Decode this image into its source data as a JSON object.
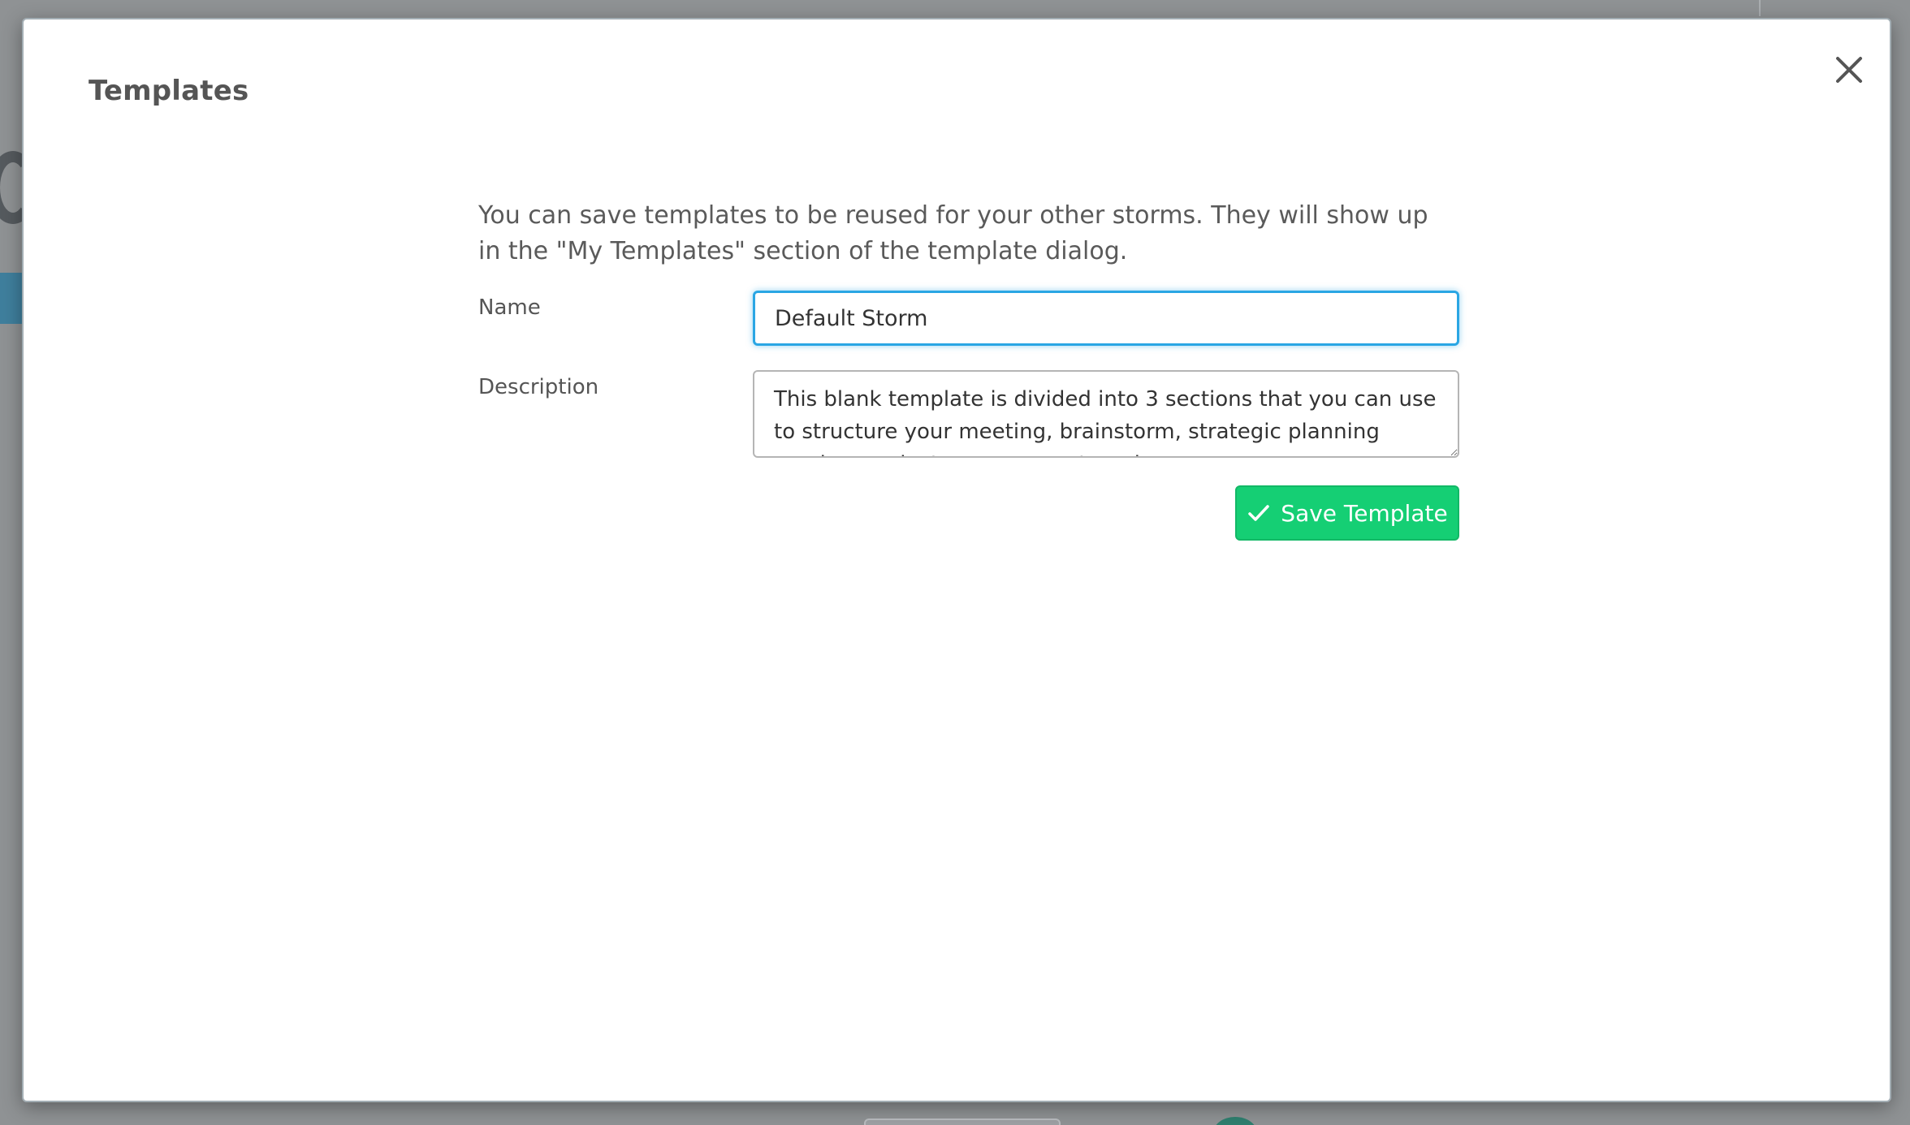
{
  "modal": {
    "title": "Templates",
    "close_icon": "close-icon",
    "intro": "You can save templates to be reused for your other storms. They will show up in the \"My Templates\" section of the template dialog.",
    "name_field": {
      "label": "Name",
      "value": "Default Storm"
    },
    "description_field": {
      "label": "Description",
      "value": "This blank template is divided into 3 sections that you can use to structure your meeting, brainstorm, strategic planning session, project management, and more."
    },
    "save_button": {
      "label": "Save Template",
      "icon": "check-icon",
      "color": "#15cf74"
    },
    "accent_color": "#2aa6e4"
  }
}
